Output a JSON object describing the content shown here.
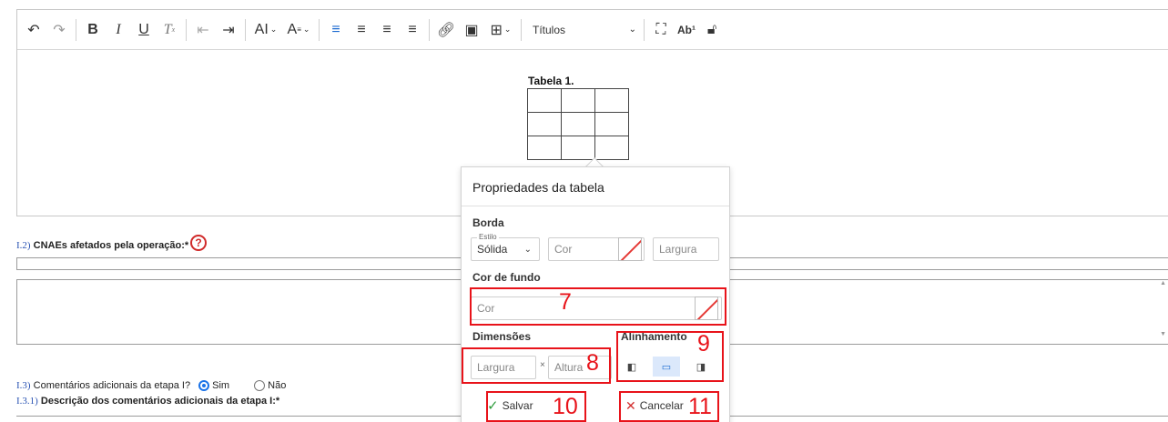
{
  "toolbar": {
    "italic_label": "I",
    "underline_label": "U",
    "font_size_label": "AI",
    "headings_label": "Títulos",
    "superscript_label": "Ab¹"
  },
  "editor": {
    "table_caption": "Tabela 1."
  },
  "form": {
    "q12_num": "I.2)",
    "q12_label": "CNAEs afetados pela operação:*",
    "q13_num": "I.3)",
    "q13_label": "Comentários adicionais da etapa I?",
    "q13_yes": "Sim",
    "q13_no": "Não",
    "q131_num": "I.3.1)",
    "q131_label": "Descrição dos comentários adicionais da etapa I:*"
  },
  "popup": {
    "title": "Propriedades da tabela",
    "border_section": "Borda",
    "style_legend": "Estilo",
    "style_value": "Sólida",
    "border_color_placeholder": "Cor",
    "border_width_placeholder": "Largura",
    "bg_section": "Cor de fundo",
    "bg_color_placeholder": "Cor",
    "dim_section": "Dimensões",
    "width_placeholder": "Largura",
    "times": "×",
    "height_placeholder": "Altura",
    "align_section": "Alinhamento",
    "save_label": "Salvar",
    "cancel_label": "Cancelar"
  },
  "annotations": {
    "bg_color": "7",
    "dimensions": "8",
    "alignment": "9",
    "save": "10",
    "cancel": "11"
  },
  "colors": {
    "annotation_red": "#e8131a",
    "accent_blue": "#1b6ad0",
    "save_green": "#2e9c3c",
    "cancel_red": "#d32f2f"
  }
}
